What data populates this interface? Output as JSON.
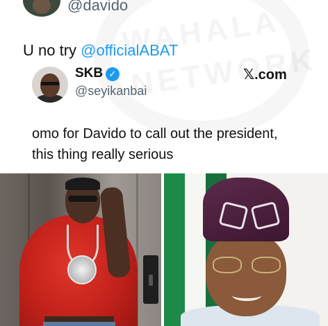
{
  "top": {
    "handle": "@davido"
  },
  "tweet": {
    "text_prefix": "U no try ",
    "mention": "@officialABAT"
  },
  "quoted": {
    "name": "SKB",
    "handle": "@seyikanbai",
    "source": "𝕏.com",
    "text": "omo for Davido to call out the president, this thing really serious"
  },
  "watermark": {
    "line1": "WAHALA",
    "line2": "NETWORK"
  },
  "colors": {
    "mention": "#1d9bf0",
    "verified": "#1d9bf0",
    "handle_gray": "#536471"
  },
  "icons": [
    "verified-badge-icon",
    "x-logo-icon"
  ]
}
